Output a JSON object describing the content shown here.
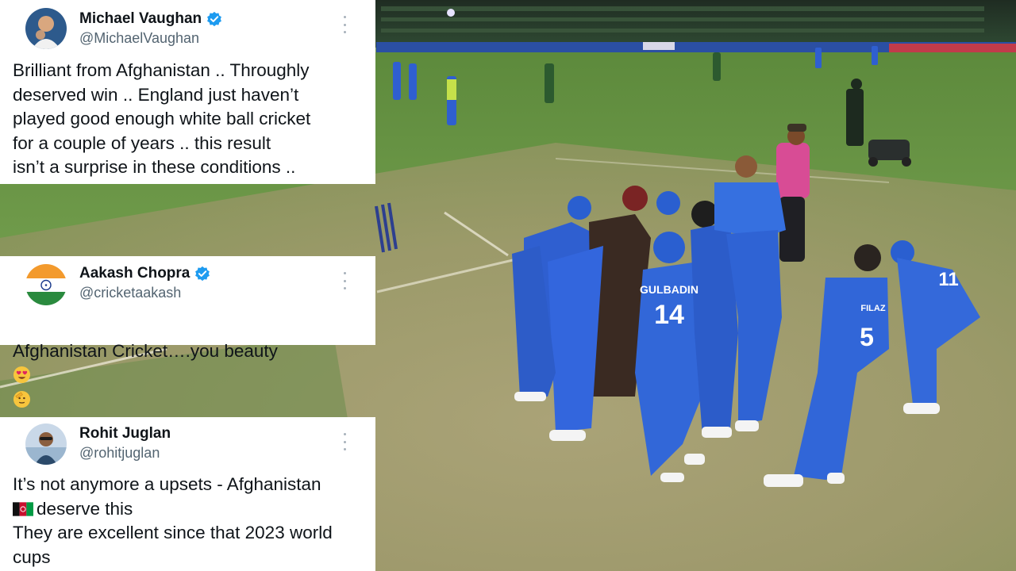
{
  "colors": {
    "card_bg": "#ffffff",
    "text_primary": "#0f1419",
    "text_secondary": "#536471",
    "verified_blue": "#1d9bf0",
    "jersey_blue": "#2f5fd0"
  },
  "tweets": [
    {
      "display_name": "Michael Vaughan",
      "handle": "@MichaelVaughan",
      "verified": true,
      "avatar_icon": "avatar-photo-icon",
      "text": "Brilliant from Afghanistan .. Throughly\ndeserved win .. England just haven’t\nplayed good enough white ball cricket\nfor a couple of years .. this result\nisn’t a surprise in these conditions .."
    },
    {
      "display_name": "Aakash Chopra",
      "handle": "@cricketaakash",
      "verified": true,
      "avatar_icon": "india-flag-icon",
      "text": "Afghanistan Cricket….you beauty",
      "emojis": [
        "heart-eyes-emoji-icon",
        "salute-emoji-icon"
      ]
    },
    {
      "display_name": "Rohit Juglan",
      "handle": "@rohitjuglan",
      "verified": false,
      "avatar_icon": "avatar-photo-icon",
      "text_line1": "It’s not anymore a upsets - Afghanistan",
      "flag_icon": "afghanistan-flag-icon",
      "text_line2": "deserve this",
      "text_rest": "They are excellent since that 2023 world\ncups"
    }
  ],
  "scene": {
    "description_icon": "cricket-celebration-photo",
    "jersey_numbers": [
      "14",
      "5",
      "11"
    ],
    "jersey_names": [
      "GULBADIN",
      "FILAZ"
    ]
  }
}
